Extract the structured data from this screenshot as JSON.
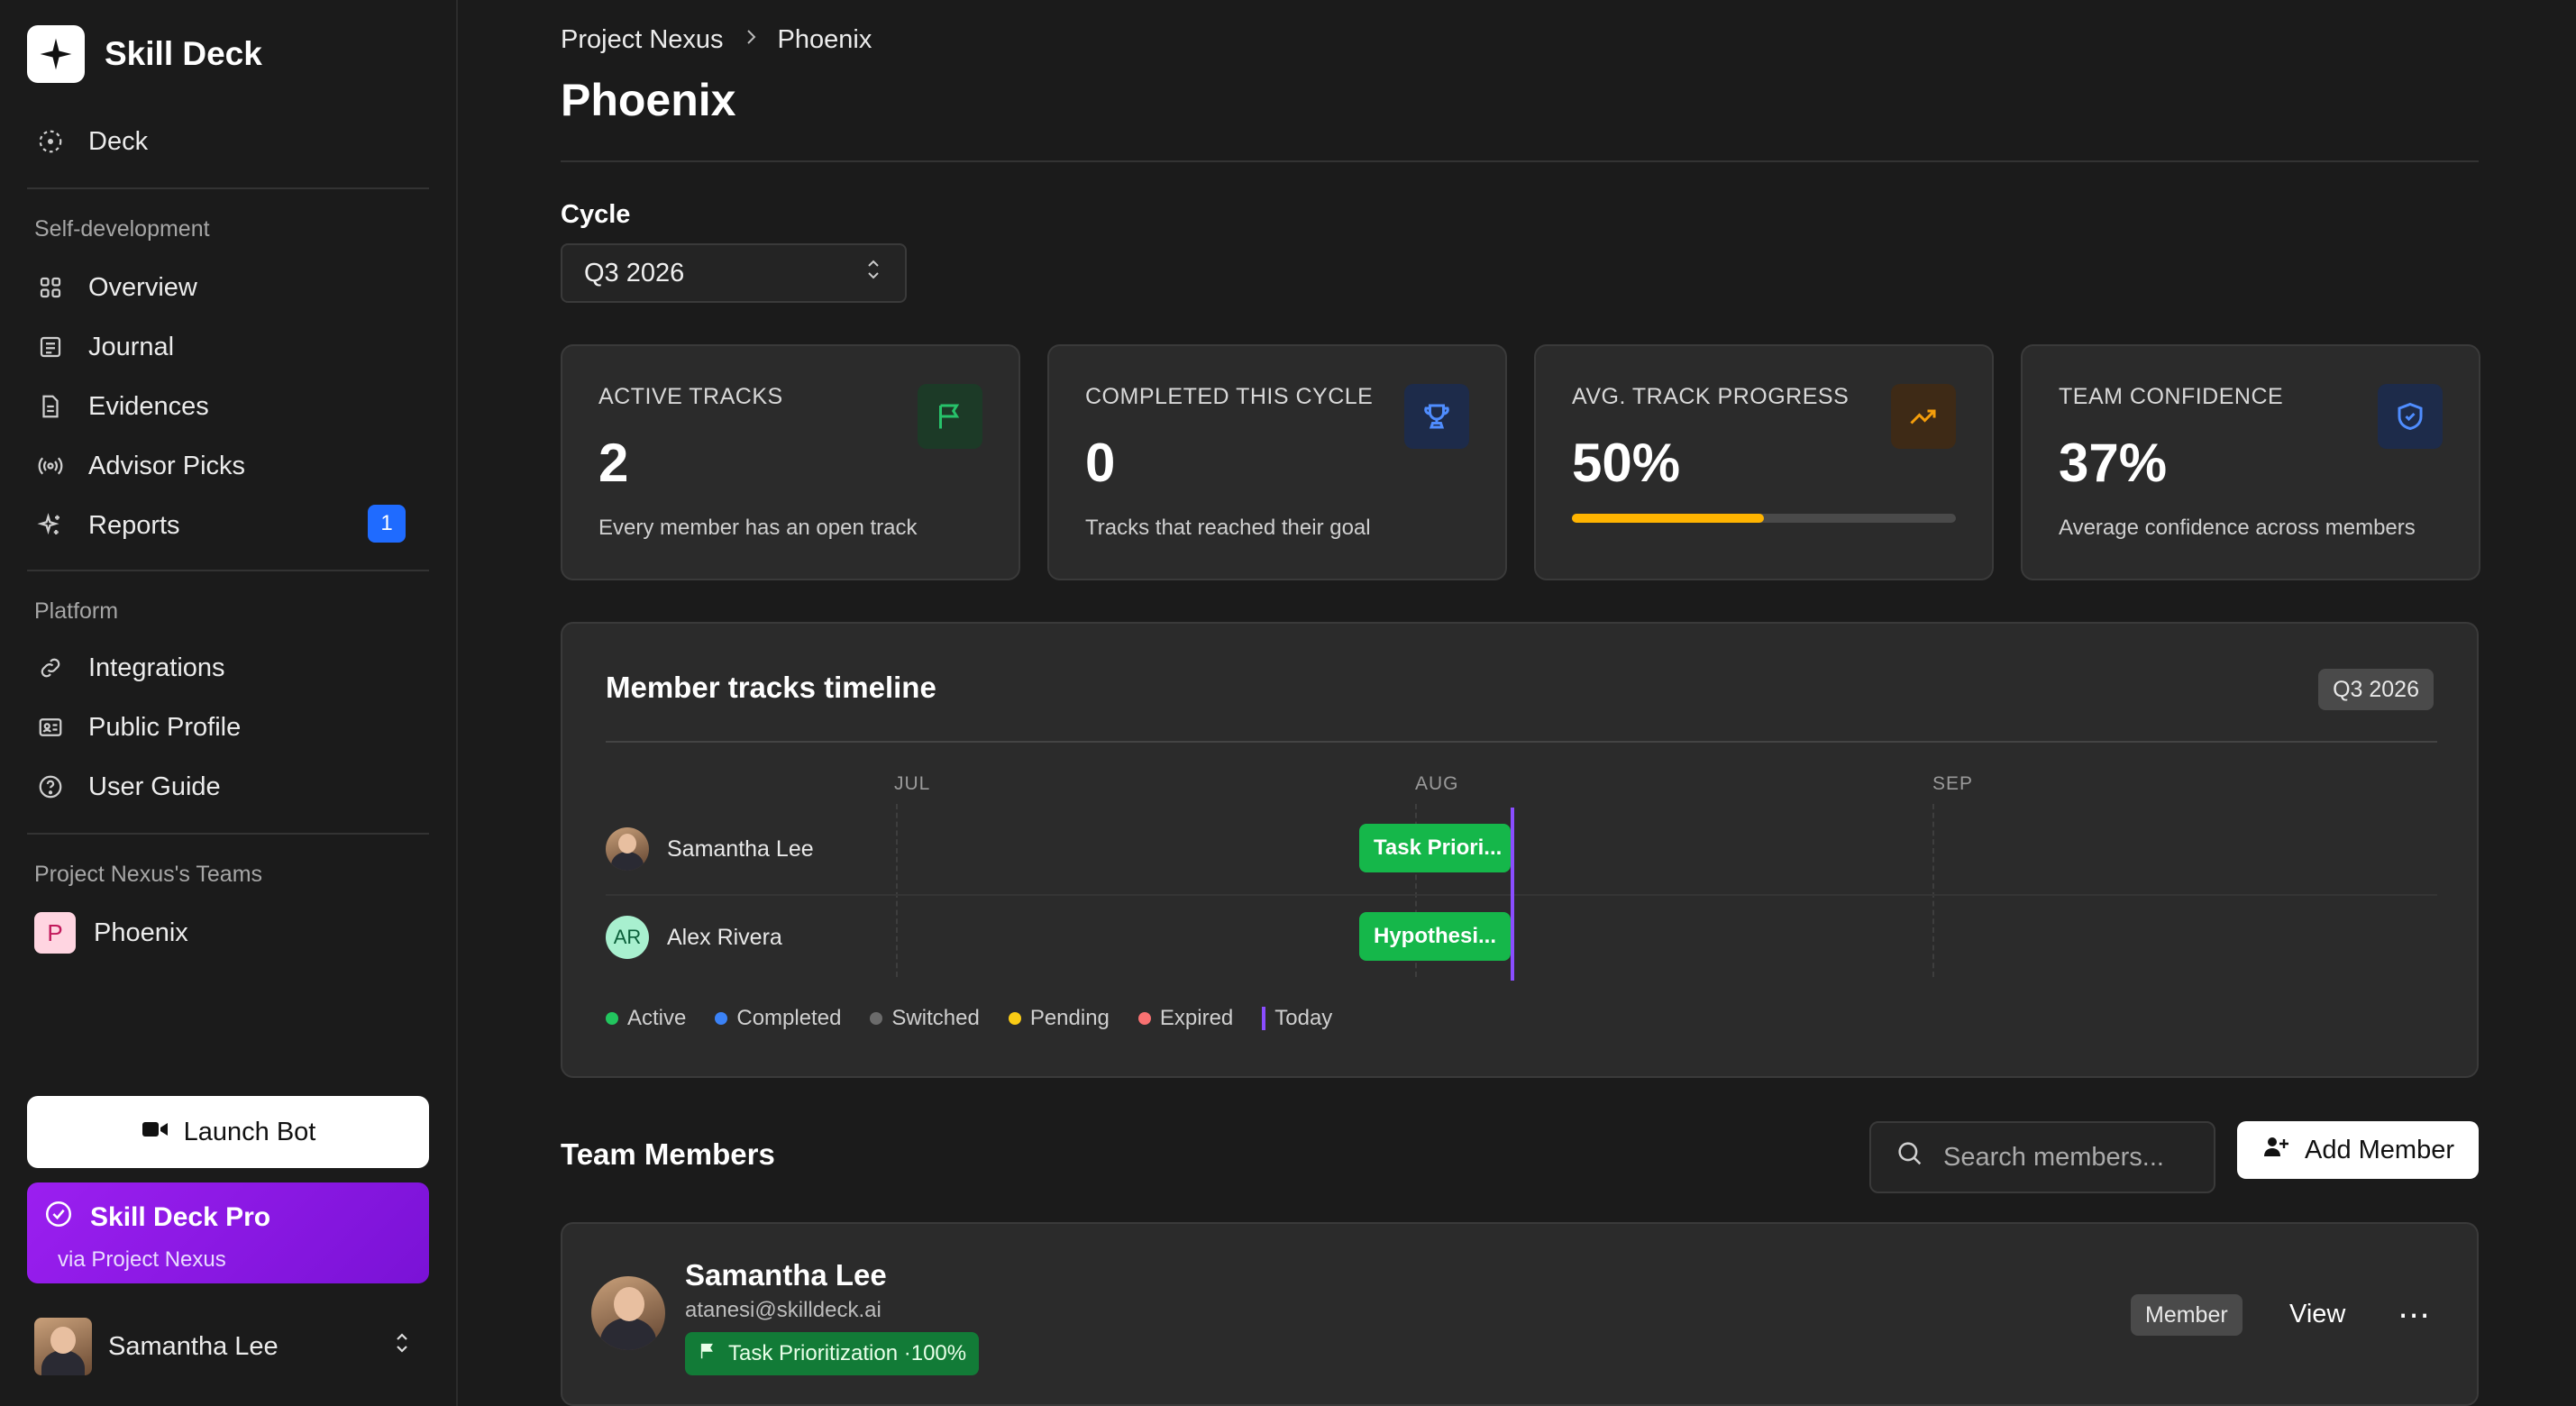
{
  "brand": {
    "name": "Skill Deck"
  },
  "sidebar": {
    "top_item": {
      "label": "Deck",
      "icon": "dotted-circle-icon"
    },
    "sections": [
      {
        "label": "Self-development"
      },
      {
        "label": "Platform"
      },
      {
        "label": "Project Nexus's Teams"
      }
    ],
    "self_dev": [
      {
        "label": "Overview",
        "icon": "grid-icon"
      },
      {
        "label": "Journal",
        "icon": "journal-icon"
      },
      {
        "label": "Evidences",
        "icon": "document-icon"
      },
      {
        "label": "Advisor Picks",
        "icon": "broadcast-icon"
      },
      {
        "label": "Reports",
        "icon": "sparkles-icon",
        "badge": "1"
      }
    ],
    "platform": [
      {
        "label": "Integrations",
        "icon": "link-icon"
      },
      {
        "label": "Public Profile",
        "icon": "id-card-icon"
      },
      {
        "label": "User Guide",
        "icon": "help-circle-icon"
      }
    ],
    "team": {
      "initial": "P",
      "label": "Phoenix"
    },
    "launch_bot": "Launch Bot",
    "pro": {
      "title": "Skill Deck Pro",
      "subtitle": "via Project Nexus"
    },
    "user": {
      "name": "Samantha Lee"
    }
  },
  "breadcrumb": {
    "parent": "Project Nexus",
    "current": "Phoenix"
  },
  "page_title": "Phoenix",
  "cycle": {
    "label": "Cycle",
    "value": "Q3 2026"
  },
  "stats": [
    {
      "label": "ACTIVE TRACKS",
      "value": "2",
      "desc": "Every member has an open track",
      "icon": "flag-icon",
      "color": "#1f9d4f"
    },
    {
      "label": "COMPLETED THIS CYCLE",
      "value": "0",
      "desc": "Tracks that reached their goal",
      "icon": "trophy-icon",
      "color": "#3b82f6"
    },
    {
      "label": "AVG. TRACK PROGRESS",
      "value": "50%",
      "progress": 0.5,
      "icon": "trending-up-icon",
      "color": "#f59e0b"
    },
    {
      "label": "TEAM CONFIDENCE",
      "value": "37%",
      "desc": "Average confidence across members",
      "icon": "shield-check-icon",
      "color": "#3b82f6"
    }
  ],
  "timeline": {
    "title": "Member tracks timeline",
    "chip": "Q3 2026",
    "months": [
      "JUL",
      "AUG",
      "SEP"
    ],
    "rows": [
      {
        "name": "Samantha Lee",
        "bar": "Task Priori..."
      },
      {
        "name": "Alex Rivera",
        "initials": "AR",
        "bar": "Hypothesi..."
      }
    ],
    "legend": [
      {
        "label": "Active",
        "color": "#22c55e"
      },
      {
        "label": "Completed",
        "color": "#3b82f6"
      },
      {
        "label": "Switched",
        "color": "#6b6b6b"
      },
      {
        "label": "Pending",
        "color": "#facc15"
      },
      {
        "label": "Expired",
        "color": "#f87171"
      },
      {
        "label": "Today",
        "color": "#8a4dff"
      }
    ]
  },
  "members": {
    "title": "Team Members",
    "search_placeholder": "Search members...",
    "add_label": "Add Member",
    "list": [
      {
        "name": "Samantha Lee",
        "email": "atanesi@skilldeck.ai",
        "track": "Task Prioritization ·100%",
        "role": "Member",
        "view": "View",
        "more": "⋯"
      }
    ]
  }
}
